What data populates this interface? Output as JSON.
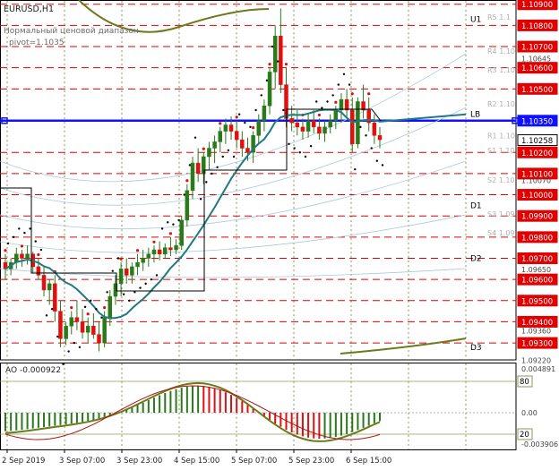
{
  "header": {
    "symbol": "EURUSD,H1",
    "indicator_name": "Нормальный ценовой диапазон",
    "pivot_label": "pivot=1.1035"
  },
  "ao": {
    "label": "AO -0.000922",
    "scale": [
      "0.004891",
      "0.00",
      "-0.003906"
    ],
    "markers": [
      "80",
      "20"
    ]
  },
  "price_axis": [
    {
      "label": "1.10900",
      "value": 1.109,
      "boxed": true
    },
    {
      "label": "1.10800",
      "value": 1.108,
      "boxed": true
    },
    {
      "label": "1.10700",
      "value": 1.107,
      "boxed": true
    },
    {
      "label": "1.10645",
      "value": 1.10645,
      "boxed": false
    },
    {
      "label": "1.10600",
      "value": 1.106,
      "boxed": true
    },
    {
      "label": "1.10500",
      "value": 1.105,
      "boxed": true
    },
    {
      "label": "1.10350",
      "value": 1.1035,
      "boxed": true,
      "blue": true
    },
    {
      "label": "1.10258",
      "value": 1.10258,
      "boxed": true,
      "current": true
    },
    {
      "label": "1.10200",
      "value": 1.102,
      "boxed": true
    },
    {
      "label": "1.10100",
      "value": 1.101,
      "boxed": true
    },
    {
      "label": "1.10070",
      "value": 1.1007,
      "boxed": false
    },
    {
      "label": "1.10000",
      "value": 1.1,
      "boxed": true
    },
    {
      "label": "1.09900",
      "value": 1.099,
      "boxed": true
    },
    {
      "label": "1.09800",
      "value": 1.098,
      "boxed": true
    },
    {
      "label": "1.09700",
      "value": 1.097,
      "boxed": true
    },
    {
      "label": "1.09650",
      "value": 1.0965,
      "boxed": false
    },
    {
      "label": "1.09600",
      "value": 1.096,
      "boxed": true
    },
    {
      "label": "1.09500",
      "value": 1.095,
      "boxed": true
    },
    {
      "label": "1.09400",
      "value": 1.094,
      "boxed": true
    },
    {
      "label": "1.09360",
      "value": 1.0936,
      "boxed": false
    },
    {
      "label": "1.09300",
      "value": 1.093,
      "boxed": true
    },
    {
      "label": "1.09220",
      "value": 1.0922,
      "boxed": false
    }
  ],
  "level_labels": [
    {
      "text": "U1",
      "value": 1.1083,
      "color": "#000000"
    },
    {
      "text": "R5 1.1",
      "value": 1.1084,
      "color": "#b0b0b0"
    },
    {
      "text": "R4 1.10",
      "value": 1.1068,
      "color": "#b0b0b0"
    },
    {
      "text": "R3 1.10",
      "value": 1.1059,
      "color": "#b0b0b0"
    },
    {
      "text": "R2 1.10",
      "value": 1.1043,
      "color": "#b0b0b0"
    },
    {
      "text": "LB",
      "value": 1.1038,
      "color": "#000000"
    },
    {
      "text": "R1 1.10",
      "value": 1.1028,
      "color": "#b0b0b0"
    },
    {
      "text": "S1 1.10",
      "value": 1.1021,
      "color": "#b0b0b0"
    },
    {
      "text": "S2 1.10",
      "value": 1.1007,
      "color": "#b0b0b0"
    },
    {
      "text": "D1",
      "value": 1.0995,
      "color": "#000000"
    },
    {
      "text": "S3 1.09",
      "value": 1.0991,
      "color": "#b0b0b0"
    },
    {
      "text": "S4 1.09",
      "value": 1.0982,
      "color": "#b0b0b0"
    },
    {
      "text": "D2",
      "value": 1.097,
      "color": "#000000"
    },
    {
      "text": "D3",
      "value": 1.0928,
      "color": "#000000"
    }
  ],
  "time_axis": [
    {
      "label": "2 Sep 2019",
      "x": 0
    },
    {
      "label": "3 Sep 07:00",
      "x": 1
    },
    {
      "label": "3 Sep 23:00",
      "x": 2
    },
    {
      "label": "4 Sep 15:00",
      "x": 3
    },
    {
      "label": "5 Sep 07:00",
      "x": 4
    },
    {
      "label": "5 Sep 23:00",
      "x": 5
    },
    {
      "label": "6 Sep 15:00",
      "x": 6
    }
  ],
  "chart_data": {
    "type": "candlestick",
    "title": "EURUSD,H1",
    "ylim": [
      1.0922,
      1.1092
    ],
    "ohlc": [
      [
        1.0968,
        1.0972,
        1.096,
        1.0965
      ],
      [
        1.0965,
        1.097,
        1.0962,
        1.0968
      ],
      [
        1.0968,
        1.0975,
        1.0965,
        1.0972
      ],
      [
        1.0972,
        1.0974,
        1.0966,
        1.097
      ],
      [
        1.097,
        1.0976,
        1.0967,
        1.0972
      ],
      [
        1.0972,
        1.0973,
        1.0963,
        1.0966
      ],
      [
        1.0966,
        1.097,
        1.096,
        1.0962
      ],
      [
        1.0962,
        1.0966,
        1.0952,
        1.0955
      ],
      [
        1.0955,
        1.096,
        1.0948,
        1.0958
      ],
      [
        1.0958,
        1.0962,
        1.094,
        1.0945
      ],
      [
        1.0945,
        1.095,
        1.0928,
        1.0932
      ],
      [
        1.0932,
        1.094,
        1.0929,
        1.0938
      ],
      [
        1.0938,
        1.0945,
        1.0934,
        1.0942
      ],
      [
        1.0942,
        1.095,
        1.0936,
        1.094
      ],
      [
        1.094,
        1.0946,
        1.0932,
        1.0935
      ],
      [
        1.0935,
        1.0942,
        1.093,
        1.0938
      ],
      [
        1.0938,
        1.0944,
        1.0932,
        1.0934
      ],
      [
        1.0934,
        1.094,
        1.0926,
        1.093
      ],
      [
        1.093,
        1.0945,
        1.0928,
        1.0942
      ],
      [
        1.0942,
        1.0955,
        1.0938,
        1.0952
      ],
      [
        1.0952,
        1.0962,
        1.0948,
        1.0958
      ],
      [
        1.0958,
        1.0968,
        1.0952,
        1.0965
      ],
      [
        1.0965,
        1.097,
        1.0958,
        1.0962
      ],
      [
        1.0962,
        1.0968,
        1.0958,
        1.0966
      ],
      [
        1.0966,
        1.0972,
        1.0962,
        1.0968
      ],
      [
        1.0968,
        1.0974,
        1.0964,
        1.097
      ],
      [
        1.097,
        1.0975,
        1.0966,
        1.0972
      ],
      [
        1.0972,
        1.0976,
        1.0968,
        1.0974
      ],
      [
        1.0974,
        1.0978,
        1.0969,
        1.0972
      ],
      [
        1.0972,
        1.0977,
        1.097,
        1.0975
      ],
      [
        1.0975,
        1.098,
        1.0971,
        1.0974
      ],
      [
        1.0974,
        1.0979,
        1.0972,
        1.0976
      ],
      [
        1.0976,
        1.099,
        1.0974,
        1.0988
      ],
      [
        1.0988,
        1.1005,
        1.0985,
        1.1002
      ],
      [
        1.1002,
        1.1018,
        1.0998,
        1.1015
      ],
      [
        1.1015,
        1.1022,
        1.1006,
        1.101
      ],
      [
        1.101,
        1.102,
        1.1005,
        1.1018
      ],
      [
        1.1018,
        1.1025,
        1.1012,
        1.1022
      ],
      [
        1.1022,
        1.1028,
        1.1015,
        1.1025
      ],
      [
        1.1025,
        1.1032,
        1.102,
        1.103
      ],
      [
        1.103,
        1.1036,
        1.1024,
        1.1033
      ],
      [
        1.1033,
        1.1037,
        1.1026,
        1.103
      ],
      [
        1.103,
        1.1035,
        1.1022,
        1.1026
      ],
      [
        1.1026,
        1.103,
        1.1018,
        1.1022
      ],
      [
        1.1022,
        1.1027,
        1.1016,
        1.102
      ],
      [
        1.102,
        1.103,
        1.1015,
        1.1028
      ],
      [
        1.1028,
        1.1038,
        1.1024,
        1.1035
      ],
      [
        1.1035,
        1.1045,
        1.103,
        1.1042
      ],
      [
        1.1042,
        1.106,
        1.1038,
        1.1058
      ],
      [
        1.1058,
        1.108,
        1.105,
        1.1075
      ],
      [
        1.1075,
        1.1088,
        1.1048,
        1.1052
      ],
      [
        1.1052,
        1.106,
        1.1032,
        1.1036
      ],
      [
        1.1036,
        1.1042,
        1.103,
        1.1034
      ],
      [
        1.1034,
        1.104,
        1.1028,
        1.1032
      ],
      [
        1.1032,
        1.1036,
        1.1026,
        1.103
      ],
      [
        1.103,
        1.1038,
        1.1027,
        1.1035
      ],
      [
        1.1035,
        1.104,
        1.1029,
        1.1032
      ],
      [
        1.1032,
        1.1036,
        1.1026,
        1.1029
      ],
      [
        1.1029,
        1.1035,
        1.1025,
        1.1032
      ],
      [
        1.1032,
        1.1038,
        1.1029,
        1.1035
      ],
      [
        1.1035,
        1.1042,
        1.1031,
        1.104
      ],
      [
        1.104,
        1.1048,
        1.1034,
        1.1045
      ],
      [
        1.1045,
        1.105,
        1.1036,
        1.104
      ],
      [
        1.104,
        1.1046,
        1.102,
        1.1024
      ],
      [
        1.1024,
        1.1046,
        1.1022,
        1.1044
      ],
      [
        1.1044,
        1.1052,
        1.1036,
        1.104
      ],
      [
        1.104,
        1.1046,
        1.103,
        1.1034
      ],
      [
        1.1034,
        1.1038,
        1.1024,
        1.1028
      ],
      [
        1.1028,
        1.1032,
        1.1022,
        1.1026
      ]
    ]
  }
}
